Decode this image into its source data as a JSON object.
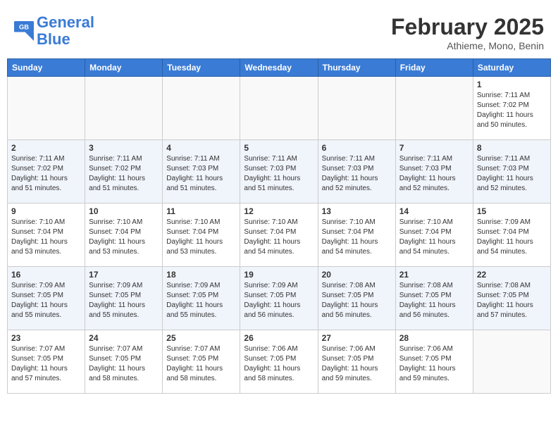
{
  "header": {
    "logo_line1": "General",
    "logo_line2": "Blue",
    "month_title": "February 2025",
    "location": "Athieme, Mono, Benin"
  },
  "days_of_week": [
    "Sunday",
    "Monday",
    "Tuesday",
    "Wednesday",
    "Thursday",
    "Friday",
    "Saturday"
  ],
  "weeks": [
    [
      {
        "num": "",
        "info": ""
      },
      {
        "num": "",
        "info": ""
      },
      {
        "num": "",
        "info": ""
      },
      {
        "num": "",
        "info": ""
      },
      {
        "num": "",
        "info": ""
      },
      {
        "num": "",
        "info": ""
      },
      {
        "num": "1",
        "info": "Sunrise: 7:11 AM\nSunset: 7:02 PM\nDaylight: 11 hours\nand 50 minutes."
      }
    ],
    [
      {
        "num": "2",
        "info": "Sunrise: 7:11 AM\nSunset: 7:02 PM\nDaylight: 11 hours\nand 51 minutes."
      },
      {
        "num": "3",
        "info": "Sunrise: 7:11 AM\nSunset: 7:02 PM\nDaylight: 11 hours\nand 51 minutes."
      },
      {
        "num": "4",
        "info": "Sunrise: 7:11 AM\nSunset: 7:03 PM\nDaylight: 11 hours\nand 51 minutes."
      },
      {
        "num": "5",
        "info": "Sunrise: 7:11 AM\nSunset: 7:03 PM\nDaylight: 11 hours\nand 51 minutes."
      },
      {
        "num": "6",
        "info": "Sunrise: 7:11 AM\nSunset: 7:03 PM\nDaylight: 11 hours\nand 52 minutes."
      },
      {
        "num": "7",
        "info": "Sunrise: 7:11 AM\nSunset: 7:03 PM\nDaylight: 11 hours\nand 52 minutes."
      },
      {
        "num": "8",
        "info": "Sunrise: 7:11 AM\nSunset: 7:03 PM\nDaylight: 11 hours\nand 52 minutes."
      }
    ],
    [
      {
        "num": "9",
        "info": "Sunrise: 7:10 AM\nSunset: 7:04 PM\nDaylight: 11 hours\nand 53 minutes."
      },
      {
        "num": "10",
        "info": "Sunrise: 7:10 AM\nSunset: 7:04 PM\nDaylight: 11 hours\nand 53 minutes."
      },
      {
        "num": "11",
        "info": "Sunrise: 7:10 AM\nSunset: 7:04 PM\nDaylight: 11 hours\nand 53 minutes."
      },
      {
        "num": "12",
        "info": "Sunrise: 7:10 AM\nSunset: 7:04 PM\nDaylight: 11 hours\nand 54 minutes."
      },
      {
        "num": "13",
        "info": "Sunrise: 7:10 AM\nSunset: 7:04 PM\nDaylight: 11 hours\nand 54 minutes."
      },
      {
        "num": "14",
        "info": "Sunrise: 7:10 AM\nSunset: 7:04 PM\nDaylight: 11 hours\nand 54 minutes."
      },
      {
        "num": "15",
        "info": "Sunrise: 7:09 AM\nSunset: 7:04 PM\nDaylight: 11 hours\nand 54 minutes."
      }
    ],
    [
      {
        "num": "16",
        "info": "Sunrise: 7:09 AM\nSunset: 7:05 PM\nDaylight: 11 hours\nand 55 minutes."
      },
      {
        "num": "17",
        "info": "Sunrise: 7:09 AM\nSunset: 7:05 PM\nDaylight: 11 hours\nand 55 minutes."
      },
      {
        "num": "18",
        "info": "Sunrise: 7:09 AM\nSunset: 7:05 PM\nDaylight: 11 hours\nand 55 minutes."
      },
      {
        "num": "19",
        "info": "Sunrise: 7:09 AM\nSunset: 7:05 PM\nDaylight: 11 hours\nand 56 minutes."
      },
      {
        "num": "20",
        "info": "Sunrise: 7:08 AM\nSunset: 7:05 PM\nDaylight: 11 hours\nand 56 minutes."
      },
      {
        "num": "21",
        "info": "Sunrise: 7:08 AM\nSunset: 7:05 PM\nDaylight: 11 hours\nand 56 minutes."
      },
      {
        "num": "22",
        "info": "Sunrise: 7:08 AM\nSunset: 7:05 PM\nDaylight: 11 hours\nand 57 minutes."
      }
    ],
    [
      {
        "num": "23",
        "info": "Sunrise: 7:07 AM\nSunset: 7:05 PM\nDaylight: 11 hours\nand 57 minutes."
      },
      {
        "num": "24",
        "info": "Sunrise: 7:07 AM\nSunset: 7:05 PM\nDaylight: 11 hours\nand 58 minutes."
      },
      {
        "num": "25",
        "info": "Sunrise: 7:07 AM\nSunset: 7:05 PM\nDaylight: 11 hours\nand 58 minutes."
      },
      {
        "num": "26",
        "info": "Sunrise: 7:06 AM\nSunset: 7:05 PM\nDaylight: 11 hours\nand 58 minutes."
      },
      {
        "num": "27",
        "info": "Sunrise: 7:06 AM\nSunset: 7:05 PM\nDaylight: 11 hours\nand 59 minutes."
      },
      {
        "num": "28",
        "info": "Sunrise: 7:06 AM\nSunset: 7:05 PM\nDaylight: 11 hours\nand 59 minutes."
      },
      {
        "num": "",
        "info": ""
      }
    ]
  ]
}
